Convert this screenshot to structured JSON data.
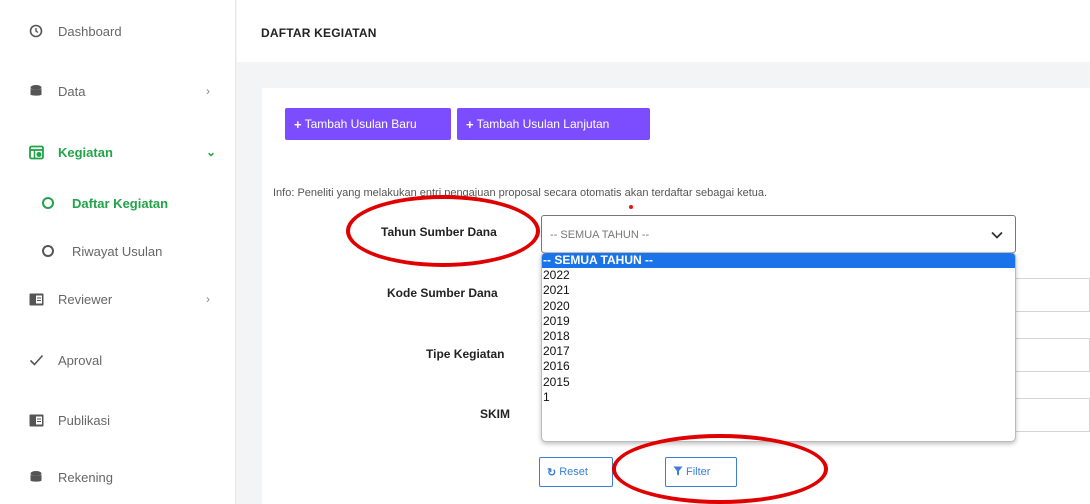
{
  "sidebar": {
    "items": [
      {
        "label": "Dashboard",
        "icon": "clock-icon"
      },
      {
        "label": "Data",
        "icon": "database-icon",
        "chevron": "›"
      },
      {
        "label": "Kegiatan",
        "icon": "calendar-icon",
        "chevron": "⌄"
      },
      {
        "label": "Reviewer",
        "icon": "book-icon",
        "chevron": "›"
      },
      {
        "label": "Aproval",
        "icon": "check-icon"
      },
      {
        "label": "Publikasi",
        "icon": "book-icon"
      },
      {
        "label": "Rekening",
        "icon": "database-icon"
      }
    ],
    "sub_items": [
      {
        "label": "Daftar Kegiatan"
      },
      {
        "label": "Riwayat Usulan"
      }
    ],
    "active_color": "#22a349"
  },
  "header": {
    "title": "DAFTAR KEGIATAN"
  },
  "toolbar": {
    "add_new_label": "Tambah Usulan Baru",
    "add_continue_label": "Tambah Usulan Lanjutan",
    "accent": "#7c4dff"
  },
  "info": "Info: Peneliti yang melakukan entri pengajuan proposal secara otomatis akan terdaftar sebagai ketua.",
  "form": {
    "tahun_label": "Tahun Sumber Dana",
    "kode_label": "Kode Sumber Dana",
    "tipe_label": "Tipe Kegiatan",
    "skim_label": "SKIM",
    "tahun_value": "-- SEMUA TAHUN --"
  },
  "dropdown": {
    "options": [
      "-- SEMUA TAHUN --",
      "2022",
      "2021",
      "2020",
      "2019",
      "2018",
      "2017",
      "2016",
      "2015",
      "1"
    ],
    "selected_index": 0
  },
  "actions": {
    "reset_label": "Reset",
    "filter_label": "Filter"
  }
}
